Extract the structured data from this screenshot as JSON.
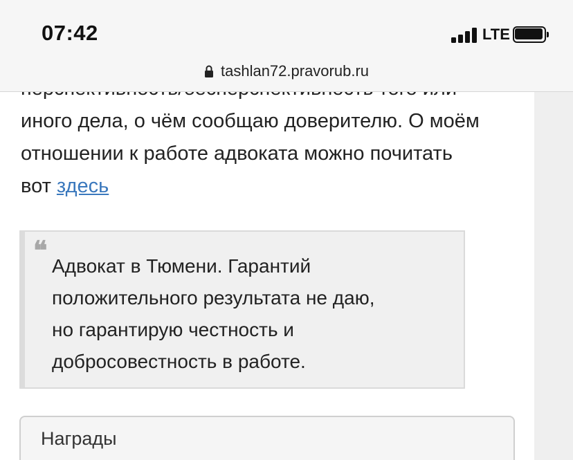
{
  "status_bar": {
    "time": "07:42",
    "network": "LTE",
    "icons": [
      "signal-icon",
      "battery-icon"
    ]
  },
  "browser": {
    "url": "tashlan72.pravorub.ru",
    "lock_icon": "lock-icon"
  },
  "article": {
    "clipped_line": "перспективность/бесперспективность того или",
    "lines": [
      "иного дела, о чём сообщаю доверителю. О моём",
      "отношении к работе адвоката можно почитать"
    ],
    "last_line_prefix": "вот ",
    "link_text": "здесь"
  },
  "quote": {
    "mark": "❝",
    "lines": [
      "Адвокат в Тюмени. Гарантий",
      "положительного результата не даю,",
      "но гарантирую честность и",
      "добросовестность в работе."
    ]
  },
  "awards": {
    "title": "Награды"
  },
  "colors": {
    "link": "#3a78bd",
    "bar_background": "#f6f6f6",
    "quote_background": "#f0f0f0"
  }
}
